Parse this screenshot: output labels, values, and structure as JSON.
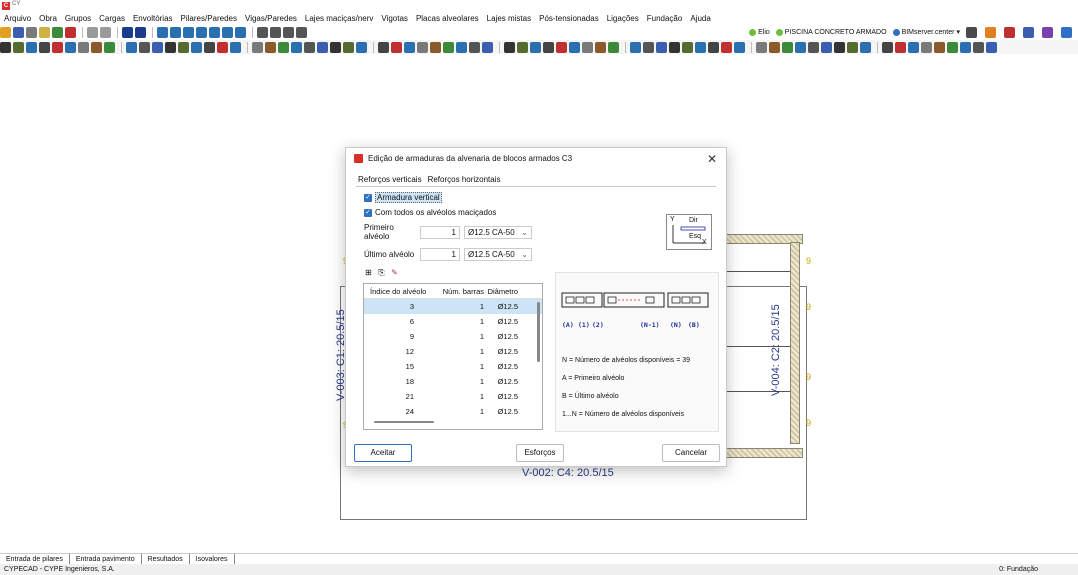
{
  "titlebar": {
    "title": "CY"
  },
  "menubar": {
    "items": [
      "Arquivo",
      "Obra",
      "Grupos",
      "Cargas",
      "Envoltórias",
      "Pilares/Paredes",
      "Vigas/Paredes",
      "Lajes maciças/nerv",
      "Vigotas",
      "Placas alveolares",
      "Lajes mistas",
      "Pós-tensionadas",
      "Ligações",
      "Fundação",
      "Ajuda"
    ]
  },
  "toolbar_right": {
    "user": "Elio",
    "project": "PISCINA CONCRETO ARMADO",
    "server": "BIMserver.center"
  },
  "drawing": {
    "label_9": "9",
    "left_wall": "V-003: C1: 20.5/15",
    "right_wall": "V-004: C2: 20.5/15",
    "bottom_wall": "V-002: C4: 20.5/15"
  },
  "dialog": {
    "title": "Edição de armaduras da alvenaria de blocos armados C3",
    "tabs": [
      "Reforços verticais",
      "Reforços horizontais"
    ],
    "armadura_vertical": "Armadura vertical",
    "com_todos": "Com todos os alvéolos maciçados",
    "primeiro": {
      "label": "Primeiro alvéolo",
      "value": "1",
      "bar": "Ø12.5 CA-50"
    },
    "ultimo": {
      "label": "Último alvéolo",
      "value": "1",
      "bar": "Ø12.5 CA-50"
    },
    "orientation": {
      "dir": "Dir",
      "esq": "Esq",
      "y": "Y",
      "x": "X"
    },
    "table": {
      "headers": [
        "Índice do alvéolo",
        "Núm. barras",
        "Diâmetro"
      ],
      "rows": [
        [
          "3",
          "1",
          "Ø12.5"
        ],
        [
          "6",
          "1",
          "Ø12.5"
        ],
        [
          "9",
          "1",
          "Ø12.5"
        ],
        [
          "12",
          "1",
          "Ø12.5"
        ],
        [
          "15",
          "1",
          "Ø12.5"
        ],
        [
          "18",
          "1",
          "Ø12.5"
        ],
        [
          "21",
          "1",
          "Ø12.5"
        ],
        [
          "24",
          "1",
          "Ø12.5"
        ]
      ]
    },
    "diagram_labels": [
      "(A)",
      "(1)",
      "(2)",
      "(N-1)",
      "(N)",
      "(B)"
    ],
    "legend": [
      "N = Número de alvéolos disponíveis = 39",
      "A = Primeiro alvéolo",
      "B = Último alvéolo",
      "1...N = Número de alvéolos disponíveis"
    ],
    "buttons": {
      "ok": "Aceitar",
      "forces": "Esforços",
      "cancel": "Cancelar"
    }
  },
  "bottom_tabs": [
    "Entrada de pilares",
    "Entrada pavimento",
    "Resultados",
    "Isovalores"
  ],
  "status": {
    "left": "CYPECAD - CYPE Ingenieros, S.A.",
    "right": "0: Fundação"
  }
}
